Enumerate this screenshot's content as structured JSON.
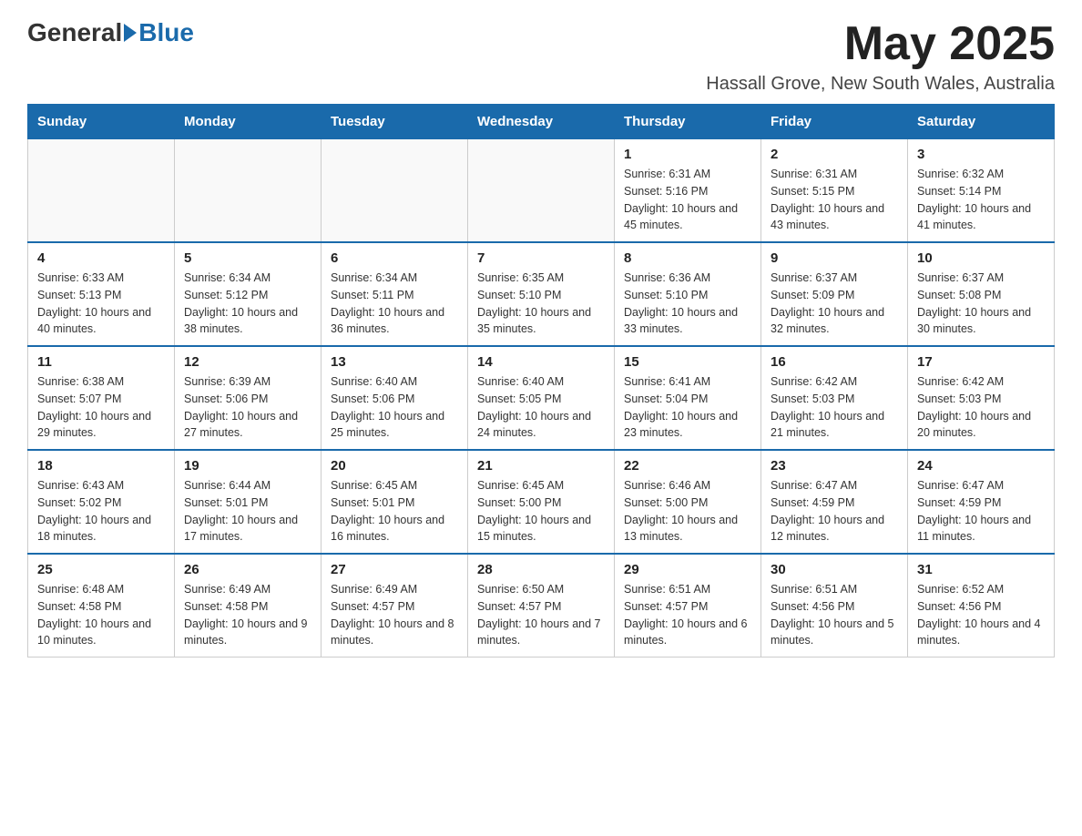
{
  "header": {
    "logo_general": "General",
    "logo_blue": "Blue",
    "month_title": "May 2025",
    "location": "Hassall Grove, New South Wales, Australia"
  },
  "days_of_week": [
    "Sunday",
    "Monday",
    "Tuesday",
    "Wednesday",
    "Thursday",
    "Friday",
    "Saturday"
  ],
  "weeks": [
    [
      {
        "day": "",
        "info": ""
      },
      {
        "day": "",
        "info": ""
      },
      {
        "day": "",
        "info": ""
      },
      {
        "day": "",
        "info": ""
      },
      {
        "day": "1",
        "info": "Sunrise: 6:31 AM\nSunset: 5:16 PM\nDaylight: 10 hours and 45 minutes."
      },
      {
        "day": "2",
        "info": "Sunrise: 6:31 AM\nSunset: 5:15 PM\nDaylight: 10 hours and 43 minutes."
      },
      {
        "day": "3",
        "info": "Sunrise: 6:32 AM\nSunset: 5:14 PM\nDaylight: 10 hours and 41 minutes."
      }
    ],
    [
      {
        "day": "4",
        "info": "Sunrise: 6:33 AM\nSunset: 5:13 PM\nDaylight: 10 hours and 40 minutes."
      },
      {
        "day": "5",
        "info": "Sunrise: 6:34 AM\nSunset: 5:12 PM\nDaylight: 10 hours and 38 minutes."
      },
      {
        "day": "6",
        "info": "Sunrise: 6:34 AM\nSunset: 5:11 PM\nDaylight: 10 hours and 36 minutes."
      },
      {
        "day": "7",
        "info": "Sunrise: 6:35 AM\nSunset: 5:10 PM\nDaylight: 10 hours and 35 minutes."
      },
      {
        "day": "8",
        "info": "Sunrise: 6:36 AM\nSunset: 5:10 PM\nDaylight: 10 hours and 33 minutes."
      },
      {
        "day": "9",
        "info": "Sunrise: 6:37 AM\nSunset: 5:09 PM\nDaylight: 10 hours and 32 minutes."
      },
      {
        "day": "10",
        "info": "Sunrise: 6:37 AM\nSunset: 5:08 PM\nDaylight: 10 hours and 30 minutes."
      }
    ],
    [
      {
        "day": "11",
        "info": "Sunrise: 6:38 AM\nSunset: 5:07 PM\nDaylight: 10 hours and 29 minutes."
      },
      {
        "day": "12",
        "info": "Sunrise: 6:39 AM\nSunset: 5:06 PM\nDaylight: 10 hours and 27 minutes."
      },
      {
        "day": "13",
        "info": "Sunrise: 6:40 AM\nSunset: 5:06 PM\nDaylight: 10 hours and 25 minutes."
      },
      {
        "day": "14",
        "info": "Sunrise: 6:40 AM\nSunset: 5:05 PM\nDaylight: 10 hours and 24 minutes."
      },
      {
        "day": "15",
        "info": "Sunrise: 6:41 AM\nSunset: 5:04 PM\nDaylight: 10 hours and 23 minutes."
      },
      {
        "day": "16",
        "info": "Sunrise: 6:42 AM\nSunset: 5:03 PM\nDaylight: 10 hours and 21 minutes."
      },
      {
        "day": "17",
        "info": "Sunrise: 6:42 AM\nSunset: 5:03 PM\nDaylight: 10 hours and 20 minutes."
      }
    ],
    [
      {
        "day": "18",
        "info": "Sunrise: 6:43 AM\nSunset: 5:02 PM\nDaylight: 10 hours and 18 minutes."
      },
      {
        "day": "19",
        "info": "Sunrise: 6:44 AM\nSunset: 5:01 PM\nDaylight: 10 hours and 17 minutes."
      },
      {
        "day": "20",
        "info": "Sunrise: 6:45 AM\nSunset: 5:01 PM\nDaylight: 10 hours and 16 minutes."
      },
      {
        "day": "21",
        "info": "Sunrise: 6:45 AM\nSunset: 5:00 PM\nDaylight: 10 hours and 15 minutes."
      },
      {
        "day": "22",
        "info": "Sunrise: 6:46 AM\nSunset: 5:00 PM\nDaylight: 10 hours and 13 minutes."
      },
      {
        "day": "23",
        "info": "Sunrise: 6:47 AM\nSunset: 4:59 PM\nDaylight: 10 hours and 12 minutes."
      },
      {
        "day": "24",
        "info": "Sunrise: 6:47 AM\nSunset: 4:59 PM\nDaylight: 10 hours and 11 minutes."
      }
    ],
    [
      {
        "day": "25",
        "info": "Sunrise: 6:48 AM\nSunset: 4:58 PM\nDaylight: 10 hours and 10 minutes."
      },
      {
        "day": "26",
        "info": "Sunrise: 6:49 AM\nSunset: 4:58 PM\nDaylight: 10 hours and 9 minutes."
      },
      {
        "day": "27",
        "info": "Sunrise: 6:49 AM\nSunset: 4:57 PM\nDaylight: 10 hours and 8 minutes."
      },
      {
        "day": "28",
        "info": "Sunrise: 6:50 AM\nSunset: 4:57 PM\nDaylight: 10 hours and 7 minutes."
      },
      {
        "day": "29",
        "info": "Sunrise: 6:51 AM\nSunset: 4:57 PM\nDaylight: 10 hours and 6 minutes."
      },
      {
        "day": "30",
        "info": "Sunrise: 6:51 AM\nSunset: 4:56 PM\nDaylight: 10 hours and 5 minutes."
      },
      {
        "day": "31",
        "info": "Sunrise: 6:52 AM\nSunset: 4:56 PM\nDaylight: 10 hours and 4 minutes."
      }
    ]
  ]
}
